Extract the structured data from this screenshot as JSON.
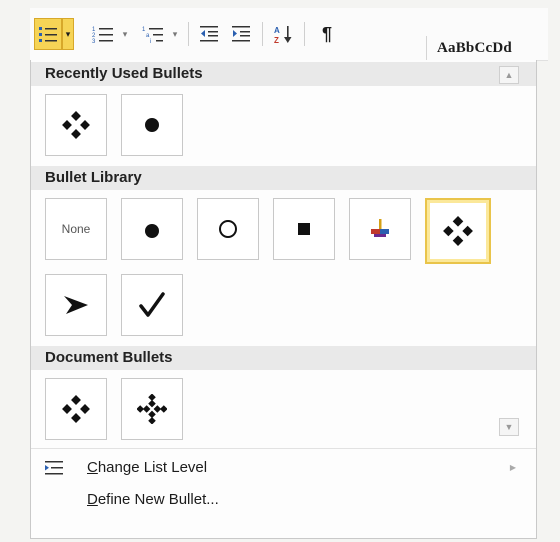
{
  "toolbar": {
    "style_preview": "AaBbCcDd",
    "icons": [
      "bullets-icon",
      "numbering-icon",
      "multilevel-list-icon",
      "decrease-indent-icon",
      "increase-indent-icon",
      "sort-icon",
      "show-formatting-marks-icon"
    ]
  },
  "sections": {
    "recent": "Recently Used Bullets",
    "library": "Bullet Library",
    "document": "Document Bullets"
  },
  "library": {
    "none_label": "None"
  },
  "menu": {
    "change_list_level": "Change List Level",
    "define_new_bullet": "Define New Bullet..."
  },
  "colors": {
    "selected_border": "#e9c44a",
    "toolbar_active": "#f6d456"
  }
}
